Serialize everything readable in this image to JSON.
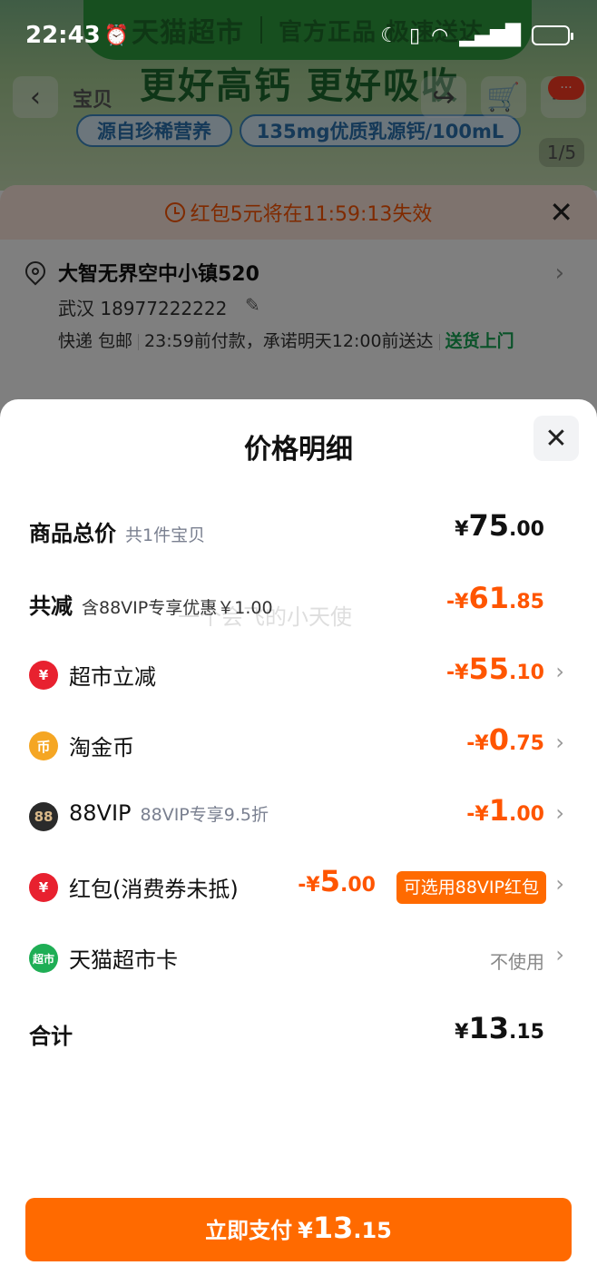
{
  "status": {
    "time": "22:43"
  },
  "bg": {
    "brand_name": "天猫超市",
    "brand_slogan": "官方正品 极速送达",
    "promo_headline": "更好高钙 更好吸收",
    "pill_1": "源自珍稀营养",
    "pill_2": "135mg优质乳源钙/100mL",
    "tab_label": "宝贝",
    "badge": "···",
    "image_index": "1/5",
    "countdown_text": "红包5元将在11:59:13失效",
    "address": "大智无界空中小镇520",
    "contact": "武汉  18977222222",
    "shipping": "快递 包邮",
    "promise": "23:59前付款，承诺明天12:00前送达",
    "door_delivery": "送货上门"
  },
  "sheet": {
    "title": "价格明细",
    "watermark": "一个会飞的小天使"
  },
  "rows": {
    "goods_total": {
      "label": "商品总价",
      "sub": "共1件宝贝",
      "prefix": "¥",
      "int": "75",
      "dec": ".00"
    },
    "total_discount": {
      "label": "共减",
      "sub": "含88VIP专享优惠￥1.00",
      "prefix": "-¥",
      "int": "61",
      "dec": ".85"
    },
    "supermarket": {
      "label": "超市立减",
      "prefix": "-¥",
      "int": "55",
      "dec": ".10"
    },
    "taojinbi": {
      "label": "淘金币",
      "prefix": "-¥",
      "int": "0",
      "dec": ".75"
    },
    "vip": {
      "label": "88VIP",
      "sub": "88VIP专享9.5折",
      "prefix": "-¥",
      "int": "1",
      "dec": ".00"
    },
    "red_packet": {
      "label": "红包(消费券未抵)",
      "prefix": "-¥",
      "int": "5",
      "dec": ".00",
      "tag": "可选用88VIP红包"
    },
    "tmall_card": {
      "label": "天猫超市卡",
      "status": "不使用"
    },
    "grand_total": {
      "label": "合计",
      "prefix": "¥",
      "int": "13",
      "dec": ".15"
    }
  },
  "pay": {
    "label": "立即支付",
    "prefix": "¥",
    "int": "13",
    "dec": ".15"
  },
  "colors": {
    "accent": "#ff6a00",
    "discount": "#ff5500",
    "delivery_green": "#15a552"
  }
}
